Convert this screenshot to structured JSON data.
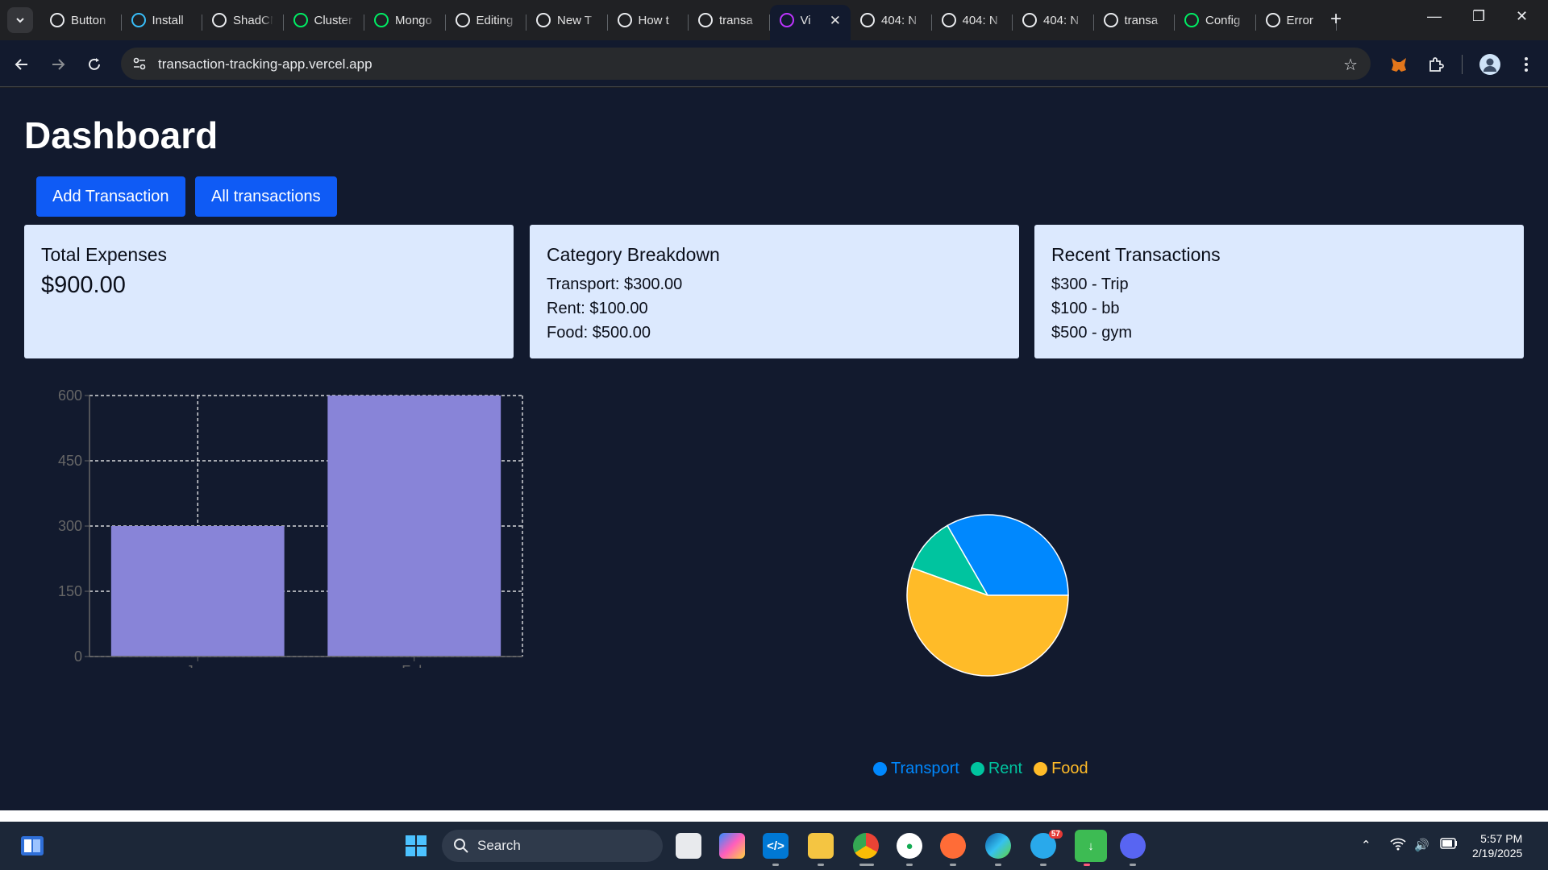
{
  "browser": {
    "tabs": [
      {
        "title": "Button",
        "favicon_color": "#e8eaed",
        "favicon": "tailwind-icon"
      },
      {
        "title": "Install",
        "favicon_color": "#38bdf8",
        "favicon": "tailwind-icon"
      },
      {
        "title": "ShadCN",
        "favicon_color": "#e8eaed",
        "favicon": "shadcn-icon"
      },
      {
        "title": "Cluster",
        "favicon_color": "#00ed64",
        "favicon": "mongodb-icon"
      },
      {
        "title": "Mongo",
        "favicon_color": "#00ed64",
        "favicon": "mongodb-icon"
      },
      {
        "title": "Editing",
        "favicon_color": "#e8eaed",
        "favicon": "github-icon"
      },
      {
        "title": "New T",
        "favicon_color": "#e8eaed",
        "favicon": "openai-icon"
      },
      {
        "title": "How t",
        "favicon_color": "#e8eaed",
        "favicon": "medium-icon"
      },
      {
        "title": "transa",
        "favicon_color": "#e8eaed",
        "favicon": "vercel-icon"
      },
      {
        "title": "Vi",
        "favicon_color": "#bd34fe",
        "favicon": "vite-icon",
        "active": true
      },
      {
        "title": "404: N",
        "favicon_color": "#e8eaed",
        "favicon": "globe-icon"
      },
      {
        "title": "404: N",
        "favicon_color": "#e8eaed",
        "favicon": "globe-icon"
      },
      {
        "title": "404: N",
        "favicon_color": "#e8eaed",
        "favicon": "globe-icon"
      },
      {
        "title": "transa",
        "favicon_color": "#e8eaed",
        "favicon": "render-icon"
      },
      {
        "title": "Config",
        "favicon_color": "#00ed64",
        "favicon": "mongodb-icon"
      },
      {
        "title": "Error",
        "favicon_color": "#e8eaed",
        "favicon": "render-icon"
      }
    ],
    "url": "transaction-tracking-app.vercel.app"
  },
  "page": {
    "title": "Dashboard",
    "buttons": {
      "add": "Add Transaction",
      "all": "All transactions"
    },
    "cards": {
      "total": {
        "title": "Total Expenses",
        "value": "$900.00"
      },
      "breakdown": {
        "title": "Category Breakdown",
        "lines": [
          "Transport: $300.00",
          "Rent: $100.00",
          "Food: $500.00"
        ]
      },
      "recent": {
        "title": "Recent Transactions",
        "lines": [
          "$300 - Trip",
          "$100 - bb",
          "$500 - gym"
        ]
      }
    }
  },
  "chart_data": [
    {
      "type": "bar",
      "categories": [
        "Jan",
        "Feb"
      ],
      "values": [
        300,
        600
      ],
      "yticks": [
        0,
        150,
        300,
        450,
        600
      ],
      "ylim": [
        0,
        600
      ],
      "grid": true,
      "bar_color": "#8884d8"
    },
    {
      "type": "pie",
      "labels": [
        "Transport",
        "Rent",
        "Food"
      ],
      "values": [
        300,
        100,
        500
      ],
      "colors": [
        "#0088fe",
        "#00c49f",
        "#ffbb28"
      ],
      "legend_position": "bottom"
    }
  ],
  "taskbar": {
    "search_label": "Search",
    "time": "5:57 PM",
    "date": "2/19/2025",
    "telegram_badge": "57"
  }
}
